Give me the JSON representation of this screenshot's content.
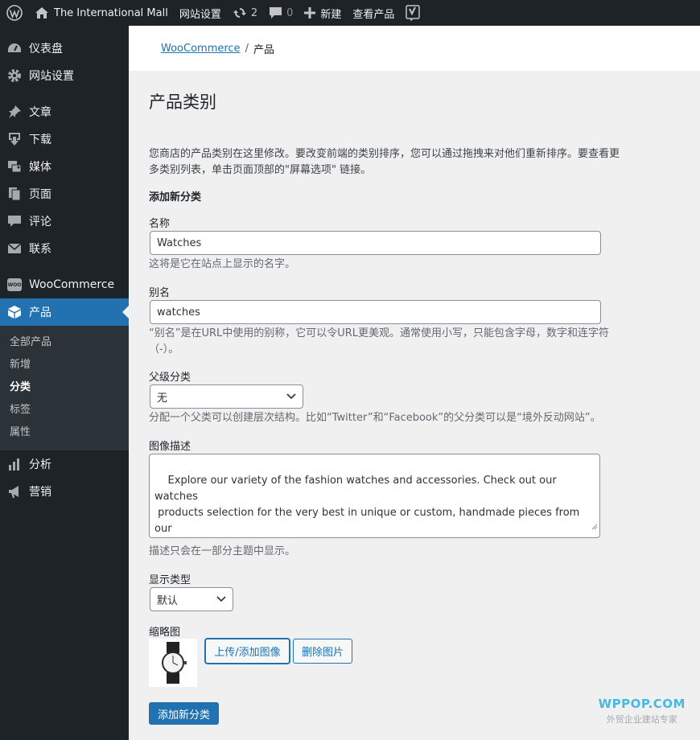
{
  "adminbar": {
    "site_name": "The International Mall",
    "site_settings": "网站设置",
    "updates_count": "2",
    "comments_count": "0",
    "new_label": "新建",
    "view_products": "查看产品"
  },
  "sidebar": {
    "items": [
      {
        "label": "仪表盘",
        "icon": "dashboard-icon"
      },
      {
        "label": "网站设置",
        "icon": "gear-icon"
      },
      {
        "label": "文章",
        "icon": "pin-icon"
      },
      {
        "label": "下载",
        "icon": "download-icon"
      },
      {
        "label": "媒体",
        "icon": "media-icon"
      },
      {
        "label": "页面",
        "icon": "pages-icon"
      },
      {
        "label": "评论",
        "icon": "comment-icon"
      },
      {
        "label": "联系",
        "icon": "mail-icon"
      },
      {
        "label": "WooCommerce",
        "icon": "woocommerce-icon"
      },
      {
        "label": "产品",
        "icon": "box-icon"
      },
      {
        "label": "分析",
        "icon": "bar-chart-icon"
      },
      {
        "label": "营销",
        "icon": "megaphone-icon"
      }
    ],
    "products_submenu": [
      "全部产品",
      "新增",
      "分类",
      "标签",
      "属性"
    ],
    "woo_badge": "WOO"
  },
  "breadcrumb": {
    "parent": "WooCommerce",
    "separator": "/",
    "current": "产品"
  },
  "page": {
    "title": "产品类别",
    "description": "您商店的产品类别在这里修改。要改变前端的类别排序，您可以通过拖拽来对他们重新排序。要查看更多类别列表，单击页面顶部的\"屏幕选项\" 链接。",
    "form_heading": "添加新分类"
  },
  "form": {
    "name_label": "名称",
    "name_value": "Watches",
    "name_help": "这将是它在站点上显示的名字。",
    "slug_label": "别名",
    "slug_value": "watches",
    "slug_help": "“别名”是在URL中使用的别称，它可以令URL更美观。通常使用小写，只能包含字母，数字和连字符（-）。",
    "parent_label": "父级分类",
    "parent_value": "无",
    "parent_help": "分配一个父类可以创建层次结构。比如“Twitter”和“Facebook”的父分类可以是“境外反动网站”。",
    "desc_label": "图像描述",
    "desc_value": "Explore our variety of the fashion watches and accessories. Check out our watches\n products selection for the very best in unique or custom, handmade pieces from our\nwatches shops.",
    "desc_help": "描述只会在一部分主题中显示。",
    "display_label": "显示类型",
    "display_value": "默认",
    "thumb_label": "缩略图",
    "upload_button": "上传/添加图像",
    "remove_button": "删除图片",
    "submit_button": "添加新分类"
  },
  "watermark": {
    "top": "WPPOP.COM",
    "bottom": "外贸企业建站专家"
  }
}
